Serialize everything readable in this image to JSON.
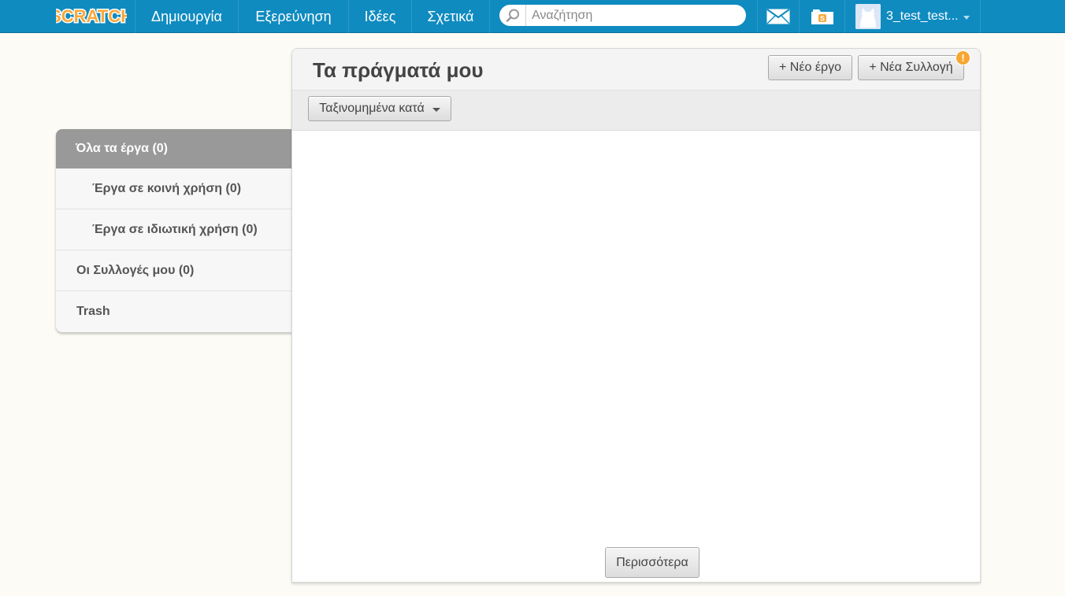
{
  "nav": {
    "logo_text": "SCRATCH",
    "create": "Δημιουργία",
    "explore": "Εξερεύνηση",
    "ideas": "Ιδέες",
    "about": "Σχετικά",
    "search_placeholder": "Αναζήτηση",
    "username": "3_test_test..."
  },
  "sidebar": {
    "items": [
      {
        "label": "Όλα τα έργα (0)"
      },
      {
        "label": "Έργα σε κοινή χρήση (0)"
      },
      {
        "label": "Έργα σε ιδιωτική χρήση (0)"
      },
      {
        "label": "Οι Συλλογές μου (0)"
      },
      {
        "label": "Trash"
      }
    ]
  },
  "main": {
    "title": "Τα πράγματά μου",
    "new_project": "+ Νέο έργο",
    "new_collection": "+ Νέα Συλλογή",
    "alert_badge": "!",
    "sort_label": "Ταξινομημένα κατά",
    "more_button": "Περισσότερα"
  },
  "colors": {
    "topbar": "#0f8bc0",
    "background": "#fcfbf5",
    "badge": "#f7a631"
  }
}
